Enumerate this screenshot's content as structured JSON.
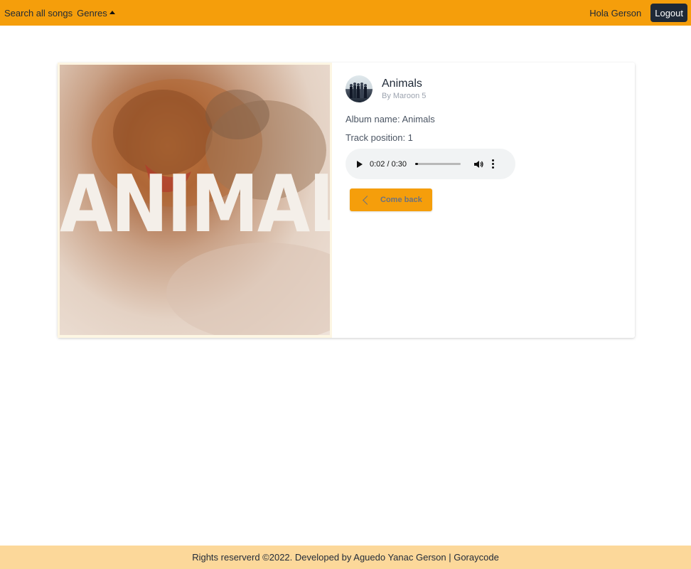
{
  "nav": {
    "search_label": "Search all songs",
    "genres_label": "Genres",
    "greeting": "Hola Gerson",
    "logout_label": "Logout",
    "accent_color": "#f59e0b"
  },
  "song": {
    "cover_text": "ANIMALS",
    "title": "Animals",
    "artist": "By Maroon 5",
    "album_line": "Album name: Animals",
    "track_line": "Track position: 1"
  },
  "player": {
    "time_display": "0:02 / 0:30",
    "progress_fraction": 0.067,
    "icons": [
      "play-icon",
      "volume-icon",
      "more-options-icon"
    ]
  },
  "actions": {
    "back_label": "Come back"
  },
  "footer": {
    "text": "Rights reserverd ©2022. Developed by Aguedo Yanac Gerson | Goraycode",
    "background": "#fcd89a"
  }
}
